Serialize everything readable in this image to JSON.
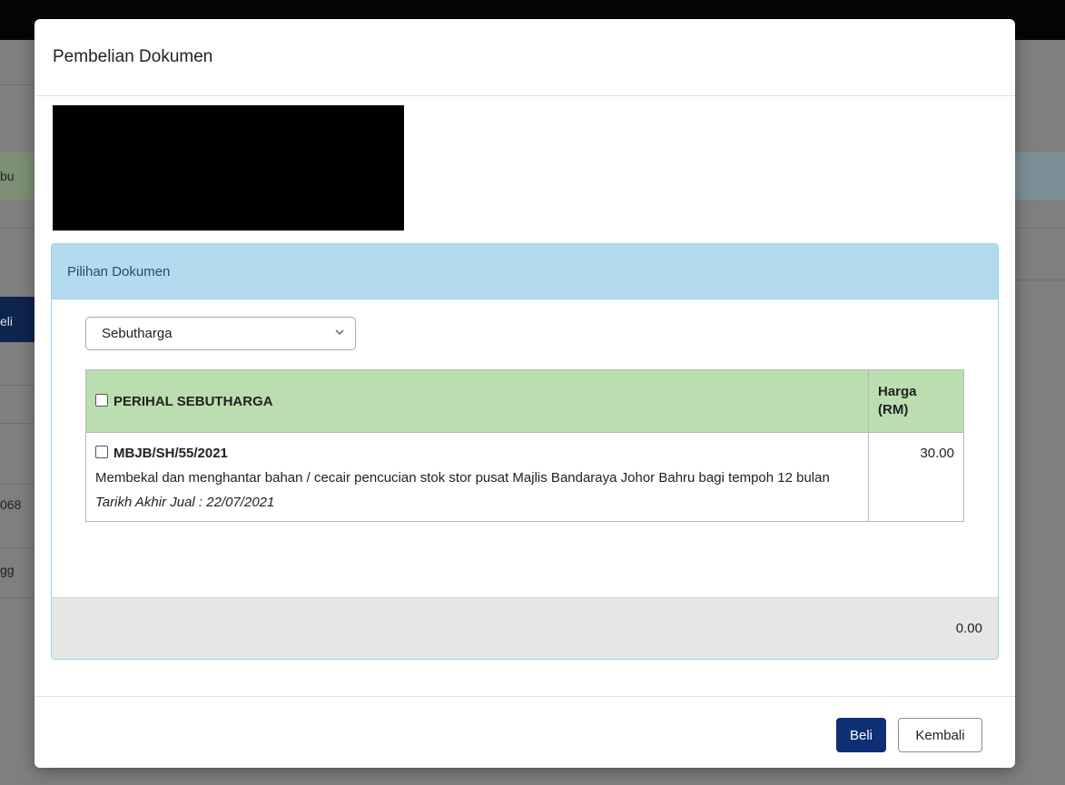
{
  "background_page": {
    "fragments": [
      "bu",
      "eli",
      "068",
      "gg"
    ]
  },
  "modal": {
    "title": "Pembelian Dokumen",
    "panel": {
      "heading": "Pilihan Dokumen",
      "select": {
        "selected": "Sebutharga"
      },
      "table": {
        "headers": {
          "perihal": "PERIHAL SEBUTHARGA",
          "harga_line1": "Harga",
          "harga_line2": "(RM)"
        },
        "rows": [
          {
            "code": "MBJB/SH/55/2021",
            "description": "Membekal dan menghantar bahan / cecair pencucian stok stor pusat Majlis Bandaraya Johor Bahru bagi tempoh 12 bulan",
            "end_date": "Tarikh Akhir Jual : 22/07/2021",
            "price": "30.00"
          }
        ]
      },
      "total": "0.00"
    },
    "buttons": {
      "buy_label": "Beli",
      "back_label": "Kembali"
    }
  },
  "colors": {
    "panel_heading": "#b3daee",
    "table_header": "#badeb0",
    "buy_button": "#0d2f73"
  }
}
